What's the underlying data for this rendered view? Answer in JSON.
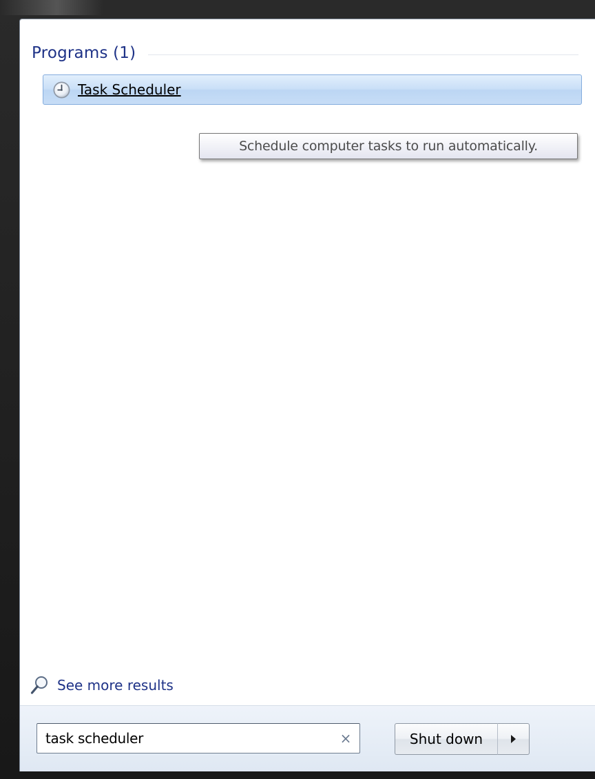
{
  "results": {
    "group_title": "Programs (1)",
    "items": [
      {
        "label": "Task Scheduler",
        "icon": "clock-icon"
      }
    ]
  },
  "tooltip": {
    "text": "Schedule computer tasks to run automatically."
  },
  "see_more": {
    "label": "See more results",
    "icon": "magnifier-icon"
  },
  "search": {
    "value": "task scheduler",
    "clear_glyph": "×"
  },
  "power": {
    "shutdown_label": "Shut down",
    "arrow_icon": "triangle-right-icon"
  },
  "colors": {
    "header_text": "#1e3287",
    "selection_border": "#84acdd",
    "selection_fill": "#c9dff7",
    "bottom_pane": "#e5ecf5"
  }
}
